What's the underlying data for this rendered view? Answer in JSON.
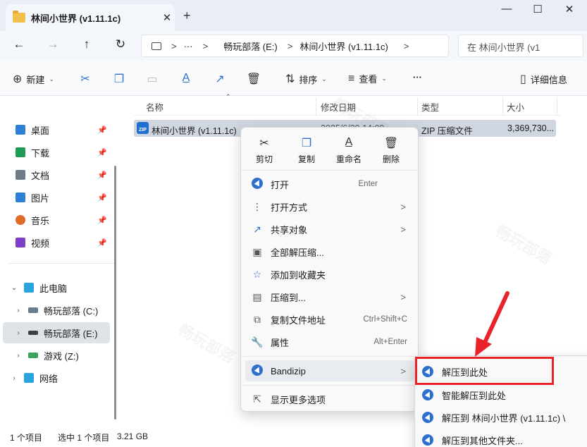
{
  "window": {
    "tab_title": "林间小世界 (v1.11.1c)",
    "tab_close": "✕",
    "new_tab": "+",
    "minimize": "—",
    "maximize": "☐",
    "close": "✕"
  },
  "nav": {
    "back": "←",
    "forward": "→",
    "up": "↑",
    "refresh": "↻",
    "breadcrumb_more": "···",
    "breadcrumb_sep": ">",
    "breadcrumb": [
      "畅玩部落 (E:)",
      "林间小世界 (v1.11.1c)"
    ],
    "search_placeholder": "在 林间小世界 (v1"
  },
  "toolbar": {
    "new_label": "新建",
    "sort_label": "排序",
    "view_label": "查看",
    "more_label": "···",
    "details_label": "详细信息"
  },
  "sidebar": {
    "quick": [
      {
        "label": "桌面",
        "color": "#2f7fd6"
      },
      {
        "label": "下载",
        "color": "#1f9d55"
      },
      {
        "label": "文档",
        "color": "#6c7a89"
      },
      {
        "label": "图片",
        "color": "#2f7fd6"
      },
      {
        "label": "音乐",
        "color": "#e06a2a"
      },
      {
        "label": "视频",
        "color": "#7d3fc7"
      }
    ],
    "this_pc": "此电脑",
    "drives": [
      {
        "label": "畅玩部落 (C:)"
      },
      {
        "label": "畅玩部落 (E:)"
      },
      {
        "label": "游戏 (Z:)"
      }
    ],
    "network": "网络"
  },
  "columns": {
    "name": "名称",
    "date": "修改日期",
    "type": "类型",
    "size": "大小"
  },
  "file": {
    "icon_text": "ZIP",
    "name": "林间小世界 (v1.11.1c)",
    "date": "2025/6/20 14:00",
    "type": "ZIP 压缩文件",
    "size": "3,369,730..."
  },
  "status": {
    "count": "1 个项目",
    "selected": "选中 1 个项目",
    "size": "3.21 GB"
  },
  "context_menu": {
    "quick_actions": [
      "剪切",
      "复制",
      "重命名",
      "删除"
    ],
    "items": [
      {
        "label": "打开",
        "shortcut": "Enter"
      },
      {
        "label": "打开方式",
        "arrow": ">"
      },
      {
        "label": "共享对象",
        "arrow": ">"
      },
      {
        "label": "全部解压缩...",
        "shortcut": ""
      },
      {
        "label": "添加到收藏夹",
        "shortcut": ""
      },
      {
        "label": "压缩到...",
        "arrow": ">"
      },
      {
        "label": "复制文件地址",
        "shortcut": "Ctrl+Shift+C"
      },
      {
        "label": "属性",
        "shortcut": "Alt+Enter"
      }
    ],
    "bandizip": {
      "label": "Bandizip",
      "arrow": ">"
    },
    "more_options": "显示更多选项"
  },
  "submenu": {
    "items": [
      "解压到此处",
      "智能解压到此处",
      "解压到 林间小世界 (v1.11.1c) \\",
      "解压到其他文件夹..."
    ]
  },
  "colors": {
    "accent": "#2f6fcc",
    "highlight": "#e8232a"
  }
}
